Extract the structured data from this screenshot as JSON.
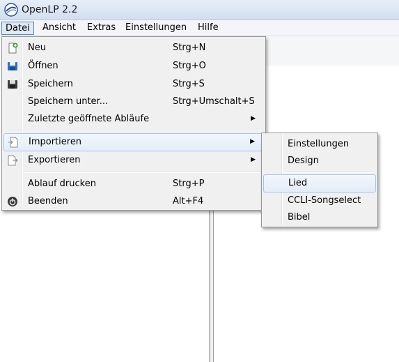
{
  "window": {
    "title": "OpenLP 2.2"
  },
  "menubar": {
    "items": [
      {
        "label": "Datei"
      },
      {
        "label": "Ansicht"
      },
      {
        "label": "Extras"
      },
      {
        "label": "Einstellungen"
      },
      {
        "label": "Hilfe"
      }
    ]
  },
  "file_menu": {
    "items": [
      {
        "label": "Neu",
        "shortcut": "Strg+N",
        "icon": "new-document-icon"
      },
      {
        "label": "Öffnen",
        "shortcut": "Strg+O",
        "icon": "open-disk-icon"
      },
      {
        "label": "Speichern",
        "shortcut": "Strg+S",
        "icon": "save-disk-icon"
      },
      {
        "label": "Speichern unter...",
        "shortcut": "Strg+Umschalt+S"
      },
      {
        "label": "Zuletzte geöffnete Abläufe",
        "submenu": true
      },
      {
        "label": "Importieren",
        "submenu": true,
        "icon": "import-icon",
        "highlighted": true
      },
      {
        "label": "Exportieren",
        "submenu": true,
        "icon": "export-icon"
      },
      {
        "label": "Ablauf drucken",
        "shortcut": "Strg+P"
      },
      {
        "label": "Beenden",
        "shortcut": "Alt+F4",
        "icon": "power-icon"
      }
    ]
  },
  "import_submenu": {
    "items": [
      {
        "label": "Einstellungen"
      },
      {
        "label": "Design"
      },
      {
        "label": "Lied",
        "highlighted": true
      },
      {
        "label": "CCLI-Songselect"
      },
      {
        "label": "Bibel"
      }
    ]
  },
  "colors": {
    "highlight_border": "#a8c3e3",
    "highlight_fill": "#e3edf8",
    "menu_background": "#f0f0f0"
  }
}
